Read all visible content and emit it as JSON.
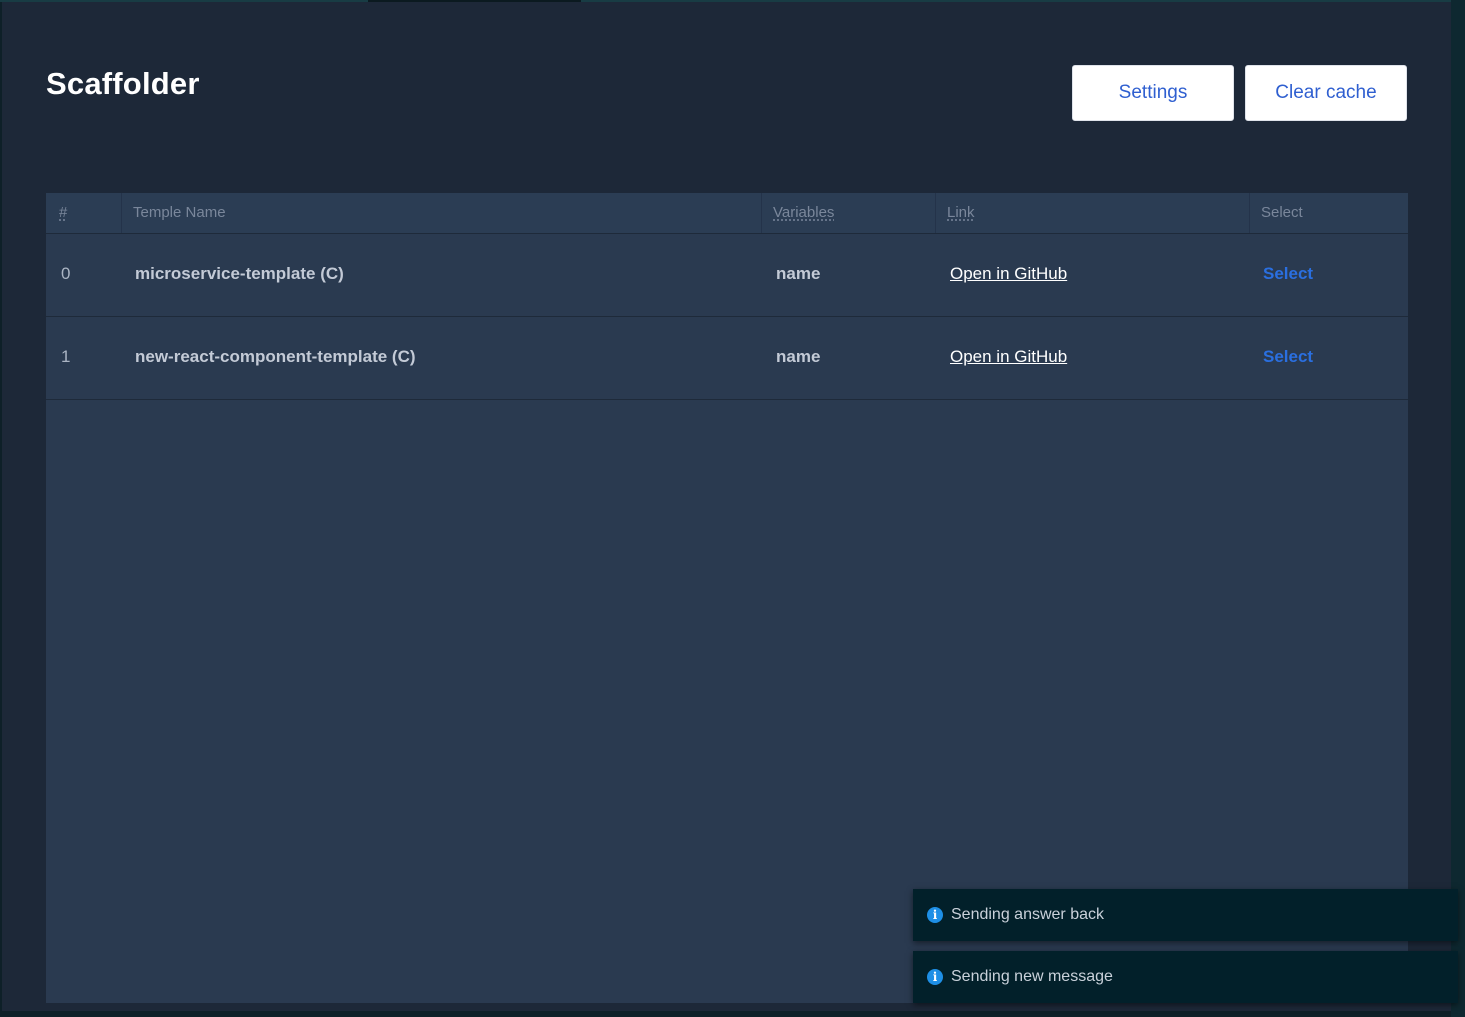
{
  "page": {
    "title": "Scaffolder"
  },
  "toolbar": {
    "settings_label": "Settings",
    "clear_cache_label": "Clear cache"
  },
  "table": {
    "columns": [
      "#",
      "Temple Name",
      "Variables",
      "Link",
      "Select"
    ],
    "rows": [
      {
        "index": "0",
        "name": "microservice-template (C)",
        "variables": "name",
        "link": "Open in GitHub",
        "select": "Select"
      },
      {
        "index": "1",
        "name": "new-react-component-template (C)",
        "variables": "name",
        "link": "Open in GitHub",
        "select": "Select"
      }
    ]
  },
  "notifications": [
    {
      "icon": "info-icon",
      "message": "Sending answer back"
    },
    {
      "icon": "info-icon",
      "message": "Sending new message"
    }
  ],
  "colors": {
    "background": "#1d2838",
    "panel": "#2a3a50",
    "accent": "#2a6fe0",
    "button_text": "#2f5fd0",
    "toast_bg": "#02202a",
    "info": "#1e8fe6"
  }
}
